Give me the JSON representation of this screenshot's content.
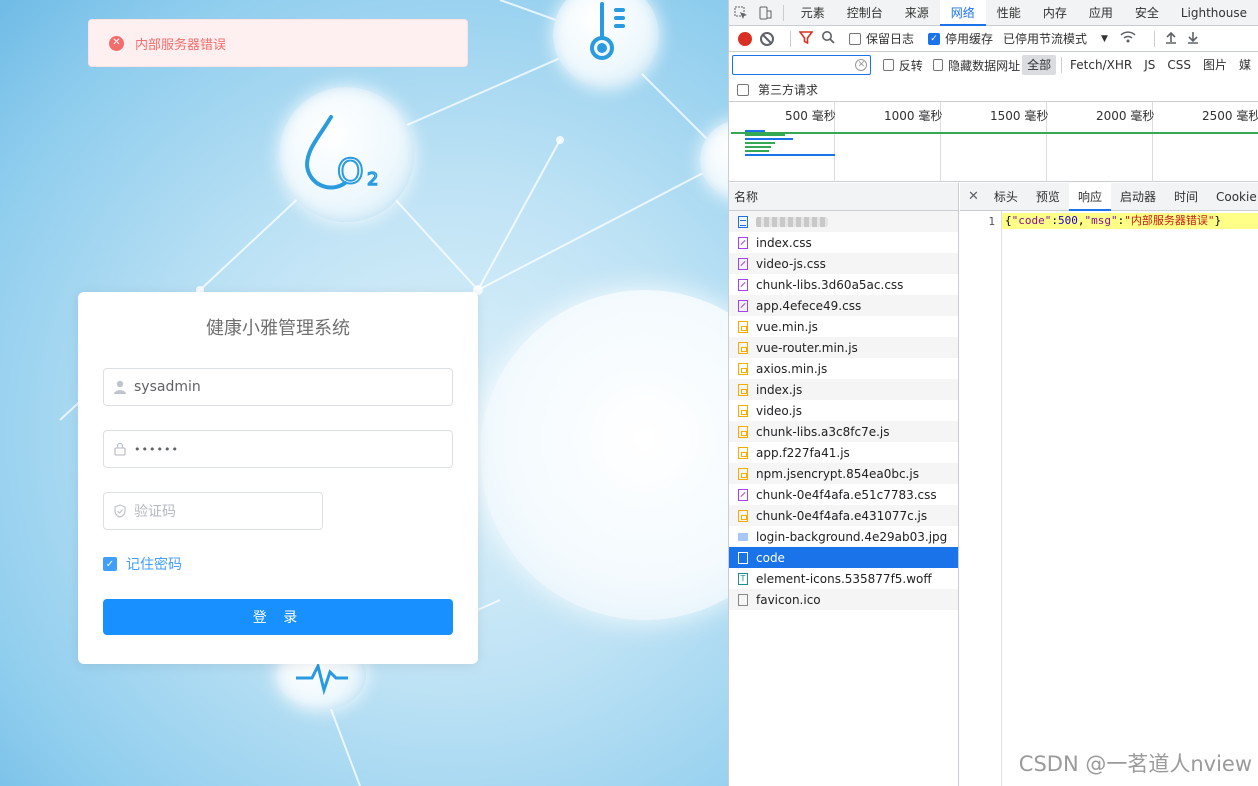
{
  "page": {
    "error_message": "内部服务器错误",
    "login": {
      "title": "健康小雅管理系统",
      "username_value": "sysadmin",
      "password_mask": "••••••",
      "captcha_placeholder": "验证码",
      "remember_label": "记住密码",
      "remember_checked": true,
      "submit_label": "登 录"
    },
    "background_icons": [
      "thermometer-icon",
      "o2-droplet-icon",
      "heartbeat-icon"
    ]
  },
  "devtools": {
    "tabs": [
      "元素",
      "控制台",
      "来源",
      "网络",
      "性能",
      "内存",
      "应用",
      "安全",
      "Lighthouse"
    ],
    "active_tab": "网络",
    "toolbar": {
      "preserve_log": "保留日志",
      "disable_cache": "停用缓存",
      "disable_cache_checked": true,
      "throttling": "已停用节流模式"
    },
    "filter": {
      "invert": "反转",
      "hide_data_urls": "隐藏数据网址",
      "types": [
        "全部",
        "Fetch/XHR",
        "JS",
        "CSS",
        "图片",
        "媒"
      ],
      "selected_type": "全部",
      "third_party": "第三方请求"
    },
    "timeline_ticks": [
      "500 毫秒",
      "1000 毫秒",
      "1500 毫秒",
      "2000 毫秒",
      "2500 毫秒"
    ],
    "requests_header": "名称",
    "requests": [
      {
        "name": "",
        "type": "doc",
        "redacted": true
      },
      {
        "name": "index.css",
        "type": "css"
      },
      {
        "name": "video-js.css",
        "type": "css"
      },
      {
        "name": "chunk-libs.3d60a5ac.css",
        "type": "css"
      },
      {
        "name": "app.4efece49.css",
        "type": "css"
      },
      {
        "name": "vue.min.js",
        "type": "js"
      },
      {
        "name": "vue-router.min.js",
        "type": "js"
      },
      {
        "name": "axios.min.js",
        "type": "js"
      },
      {
        "name": "index.js",
        "type": "js"
      },
      {
        "name": "video.js",
        "type": "js"
      },
      {
        "name": "chunk-libs.a3c8fc7e.js",
        "type": "js"
      },
      {
        "name": "app.f227fa41.js",
        "type": "js"
      },
      {
        "name": "npm.jsencrypt.854ea0bc.js",
        "type": "js"
      },
      {
        "name": "chunk-0e4f4afa.e51c7783.css",
        "type": "css"
      },
      {
        "name": "chunk-0e4f4afa.e431077c.js",
        "type": "js"
      },
      {
        "name": "login-background.4e29ab03.jpg",
        "type": "img"
      },
      {
        "name": "code",
        "type": "plain",
        "selected": true
      },
      {
        "name": "element-icons.535877f5.woff",
        "type": "font"
      },
      {
        "name": "favicon.ico",
        "type": "plain"
      }
    ],
    "detail_tabs": [
      "标头",
      "预览",
      "响应",
      "启动器",
      "时间",
      "Cookie"
    ],
    "active_detail_tab": "响应",
    "response": {
      "line_number": "1",
      "parts": [
        "{",
        "\"code\"",
        ":",
        "500",
        ",",
        "\"msg\"",
        ":",
        "\"内部服务器错误\"",
        "}"
      ]
    }
  },
  "watermark": "CSDN @一茗道人nview",
  "colors": {
    "primary_button": "#1890ff",
    "error": "#f56c6c",
    "devtools_accent": "#1a73e8"
  }
}
